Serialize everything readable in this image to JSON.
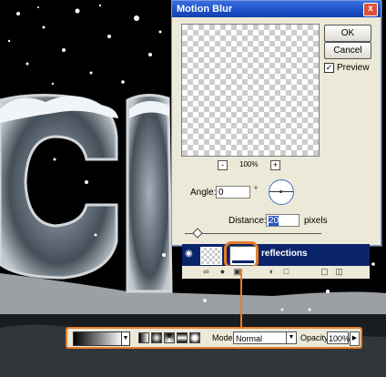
{
  "dialog": {
    "title": "Motion Blur",
    "close_glyph": "x",
    "ok_label": "OK",
    "cancel_label": "Cancel",
    "preview_label": "Preview",
    "preview_checked": "✓",
    "zoom_minus": "-",
    "zoom_plus": "+",
    "zoom_level": "100%",
    "angle_label": "Angle:",
    "angle_value": "0",
    "degree_symbol": "°",
    "distance_label": "Distance:",
    "distance_value": "20",
    "pixels_label": "pixels"
  },
  "layers": {
    "layer_name": "reflections",
    "eye_icon": "eye-icon",
    "toolbar_icons": [
      "link-icon",
      "fx-icon",
      "mask-icon",
      "adjustment-icon",
      "folder-icon",
      "new-layer-icon",
      "trash-icon"
    ]
  },
  "options_bar": {
    "mode_label": "Mode:",
    "mode_value": "Normal",
    "opacity_label": "Opacity:",
    "opacity_value": "100%"
  },
  "colors": {
    "highlight": "#E77D2A",
    "layer_selected": "#0A246A",
    "dialog_bg": "#ECE9D8"
  }
}
